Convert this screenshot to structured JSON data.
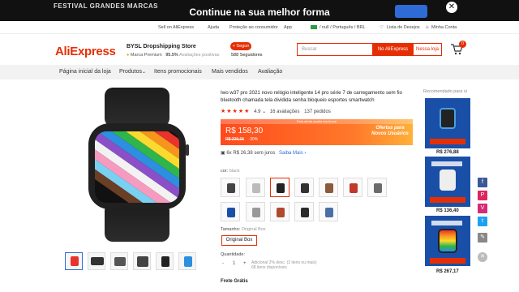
{
  "banner": {
    "promo": "FESTIVAL GRANDES MARCAS",
    "headline": "Continue na sua melhor forma"
  },
  "topbar": {
    "sell": "Sell on AliExpress",
    "help": "Ajuda",
    "protection": "Proteção ao consumidor",
    "app": "App",
    "locale": "/ null / Português / BRL",
    "wishlist": "Lista de Desejos",
    "account": "Minha Conta"
  },
  "header": {
    "logo": "AliExpress",
    "store_name": "BYSL Dropshipping Store",
    "store_badge": "Marca Premium",
    "store_rating": "95.5%",
    "store_rating_label": "Avaliações positivas",
    "follow": "+ Seguir",
    "followers": "588 Seguidores",
    "search_placeholder": "Buscar",
    "search_aliexpress": "No AliExpress",
    "search_store": "Nessa loja",
    "cart_count": "0"
  },
  "storenav": {
    "home": "Página inicial da loja",
    "products": "Produtos",
    "promo": "Itens promocionais",
    "bestsellers": "Mais vendidos",
    "reviews": "Avaliação"
  },
  "product": {
    "title": "Iwo w37 pro 2021 novo relógio inteligente 14 pro série 7 de carregamento sem fio bluetooth chamada tela dividida senha bloqueio esportes smartwatch",
    "stars": "★★★★★",
    "rating": "4.9",
    "reviews": "16 avaliações",
    "orders": "137 pedidos",
    "banner_top": "Esta oferta acaba em breve",
    "price": "R$ 158,30",
    "old_price": "R$ 226,15",
    "discount": "-30%",
    "sale_tag": "Ofertas para Novos Usuários",
    "installments": "6x R$ 26,38 sem juros",
    "installments_link": "Saiba Mais",
    "color_label": "cor:",
    "color_value": "black",
    "size_label": "Tamanho:",
    "size_value": "Original Box",
    "size_option": "Original Box",
    "qty_label": "Quantidade:",
    "qty_minus": "-",
    "qty_value": "1",
    "qty_plus": "+",
    "qty_note_1": "Adicional 2% desc. (3 itens ou mais)",
    "qty_note_2": "68 itens disponíveis",
    "shipping": "Frete Grátis"
  },
  "recommended": {
    "title": "Recomendado para si",
    "items": [
      {
        "price": "R$ 276,88"
      },
      {
        "price": "R$ 136,40"
      },
      {
        "price": "R$ 267,17"
      }
    ]
  },
  "colors": {
    "brand": "#e62e04",
    "link": "#2f6bd6"
  }
}
